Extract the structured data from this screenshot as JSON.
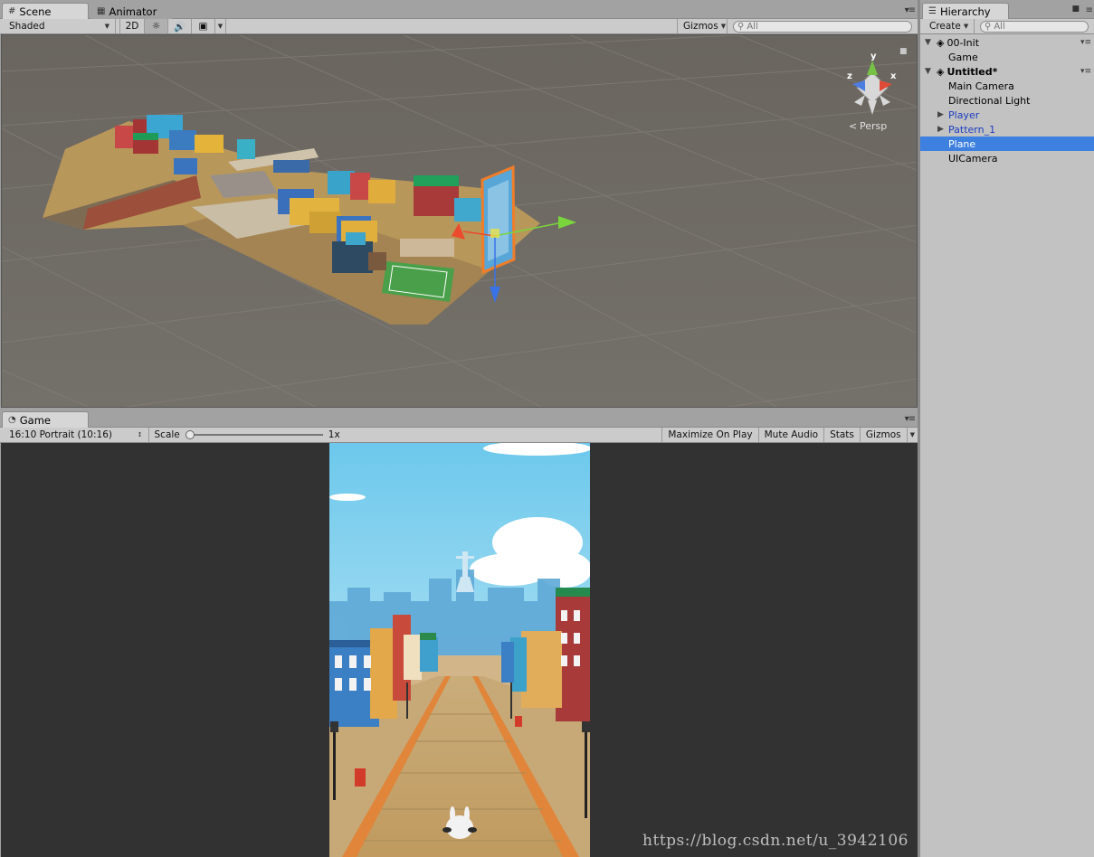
{
  "scene_panel": {
    "tabs": [
      {
        "label": "Scene",
        "icon": "grid-icon",
        "active": true
      },
      {
        "label": "Animator",
        "icon": "animator-icon",
        "active": false
      }
    ],
    "toolbar": {
      "draw_mode": "Shaded",
      "mode_2d": "2D",
      "gizmos": "Gizmos",
      "search_placeholder": "All"
    },
    "view_gizmo": {
      "x_label": "x",
      "y_label": "y",
      "z_label": "z",
      "projection": "Persp"
    }
  },
  "game_panel": {
    "tab": {
      "label": "Game",
      "icon": "pacman-icon"
    },
    "toolbar": {
      "aspect": "16:10 Portrait (10:16)",
      "scale_label": "Scale",
      "scale_value": "1x",
      "maximize_on_play": "Maximize On Play",
      "mute_audio": "Mute Audio",
      "stats": "Stats",
      "gizmos": "Gizmos"
    }
  },
  "hierarchy": {
    "tab": {
      "label": "Hierarchy",
      "icon": "list-icon"
    },
    "create_label": "Create",
    "search_placeholder": "All",
    "rows": [
      {
        "label": "00-Init",
        "type": "scene",
        "expanded": true
      },
      {
        "label": "Game",
        "type": "object"
      },
      {
        "label": "Untitled*",
        "type": "scene",
        "expanded": true
      },
      {
        "label": "Main Camera",
        "type": "object"
      },
      {
        "label": "Directional Light",
        "type": "object"
      },
      {
        "label": "Player",
        "type": "prefab",
        "collapsed": true
      },
      {
        "label": "Pattern_1",
        "type": "prefab",
        "collapsed": true
      },
      {
        "label": "Plane",
        "type": "object",
        "selected": true
      },
      {
        "label": "UICamera",
        "type": "object"
      }
    ]
  },
  "watermark": "https://blog.csdn.net/u_3942106",
  "colors": {
    "selection": "#3d80df",
    "prefab_text": "#1a3cc0",
    "scene_bg": "#6e6a63",
    "game_bg": "#323232",
    "sky": "#6cc8ec"
  }
}
